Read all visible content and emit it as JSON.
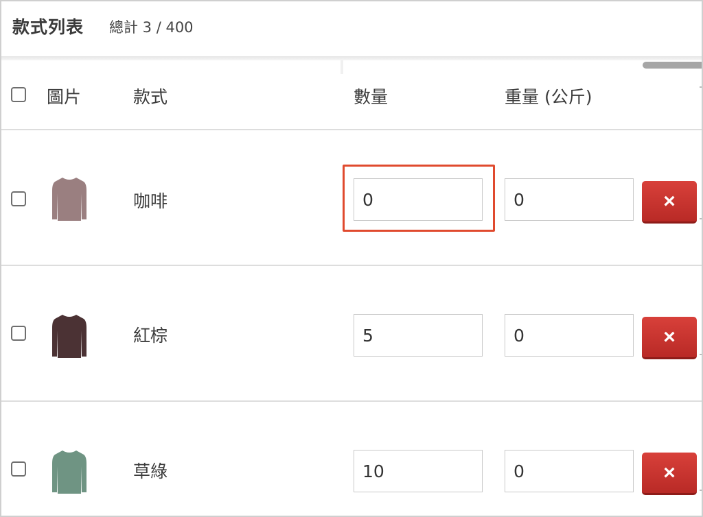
{
  "header": {
    "title": "款式列表",
    "count_text": "總計 3 / 400"
  },
  "table": {
    "columns": {
      "image": "圖片",
      "style": "款式",
      "quantity": "數量",
      "weight": "重量 (公斤)"
    },
    "rows": [
      {
        "name": "咖啡",
        "quantity": "0",
        "weight": "0",
        "shirt_color": "#9a7f80"
      },
      {
        "name": "紅棕",
        "quantity": "5",
        "weight": "0",
        "shirt_color": "#4b3234"
      },
      {
        "name": "草綠",
        "quantity": "10",
        "weight": "0",
        "shirt_color": "#6f9483"
      }
    ],
    "delete_icon": "×"
  },
  "colors": {
    "delete_button": "#c9332f",
    "highlight": "#e04a2e"
  }
}
